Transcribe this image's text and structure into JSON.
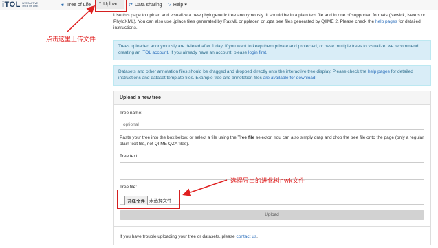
{
  "nav": {
    "logo": "iTOL",
    "logo_sub": "INTERACTIVE TREE OF LIFE",
    "items": [
      {
        "label": "Tree of Life",
        "icon": "leaf-icon"
      },
      {
        "label": "Upload",
        "icon": "upload-icon"
      },
      {
        "label": "Data sharing",
        "icon": "share-icon"
      },
      {
        "label": "Help",
        "icon": "question-icon",
        "caret": "▾"
      }
    ]
  },
  "intro": {
    "text_before_link": "Use this page to upload and visualize a new phylogenetic tree anonymously. It should be in a plain text file and in one of supported formats (Newick, Nexus or PhyloXML). You can also use .jplace files generated by RaxML or pplacer, or .qza tree files generated by QIIME 2. Please check the ",
    "link": "help pages",
    "text_after_link": " for detailed instructions."
  },
  "alert1": {
    "text1": "Trees uploaded anonymously are deleted after 1 day. If you want to keep them private and protected, or have multiple trees to visualize, we recommend creating an ",
    "link1": "iTOL account",
    "text2": ". If you already have an account, please ",
    "link2": "login first",
    "text3": "."
  },
  "alert2": {
    "text1": "Datasets and other annotation files should be dragged and dropped directly onto the interactive tree display. Please check the ",
    "link1": "help pages",
    "text2": " for detailed instructions and dataset template files. Example tree and annotation files ",
    "link2": "are available for download",
    "text3": "."
  },
  "panel": {
    "title": "Upload a new tree",
    "tree_name_label": "Tree name:",
    "tree_name_placeholder": "optional",
    "paste_text1": "Paste your tree into the box below, or select a file using the ",
    "paste_bold": "Tree file",
    "paste_text2": " selector. You can also simply drag and drop the tree file onto the page (only a regular plain text file, not QIIME QZA files).",
    "tree_text_label": "Tree text:",
    "tree_file_label": "Tree file:",
    "choose_file_button": "选择文件",
    "no_file_text": "未选择文件",
    "upload_button": "Upload",
    "footer_text": "If you have trouble uploading your tree or datasets, please ",
    "footer_link": "contact us",
    "footer_end": "."
  },
  "annotations": {
    "upload_hint": "点击这里上传文件",
    "file_hint": "选择导出的进化树nwk文件"
  },
  "colors": {
    "annotation_red": "#e02020",
    "alert_bg": "#d9edf7",
    "link_blue": "#2a6ebb"
  }
}
